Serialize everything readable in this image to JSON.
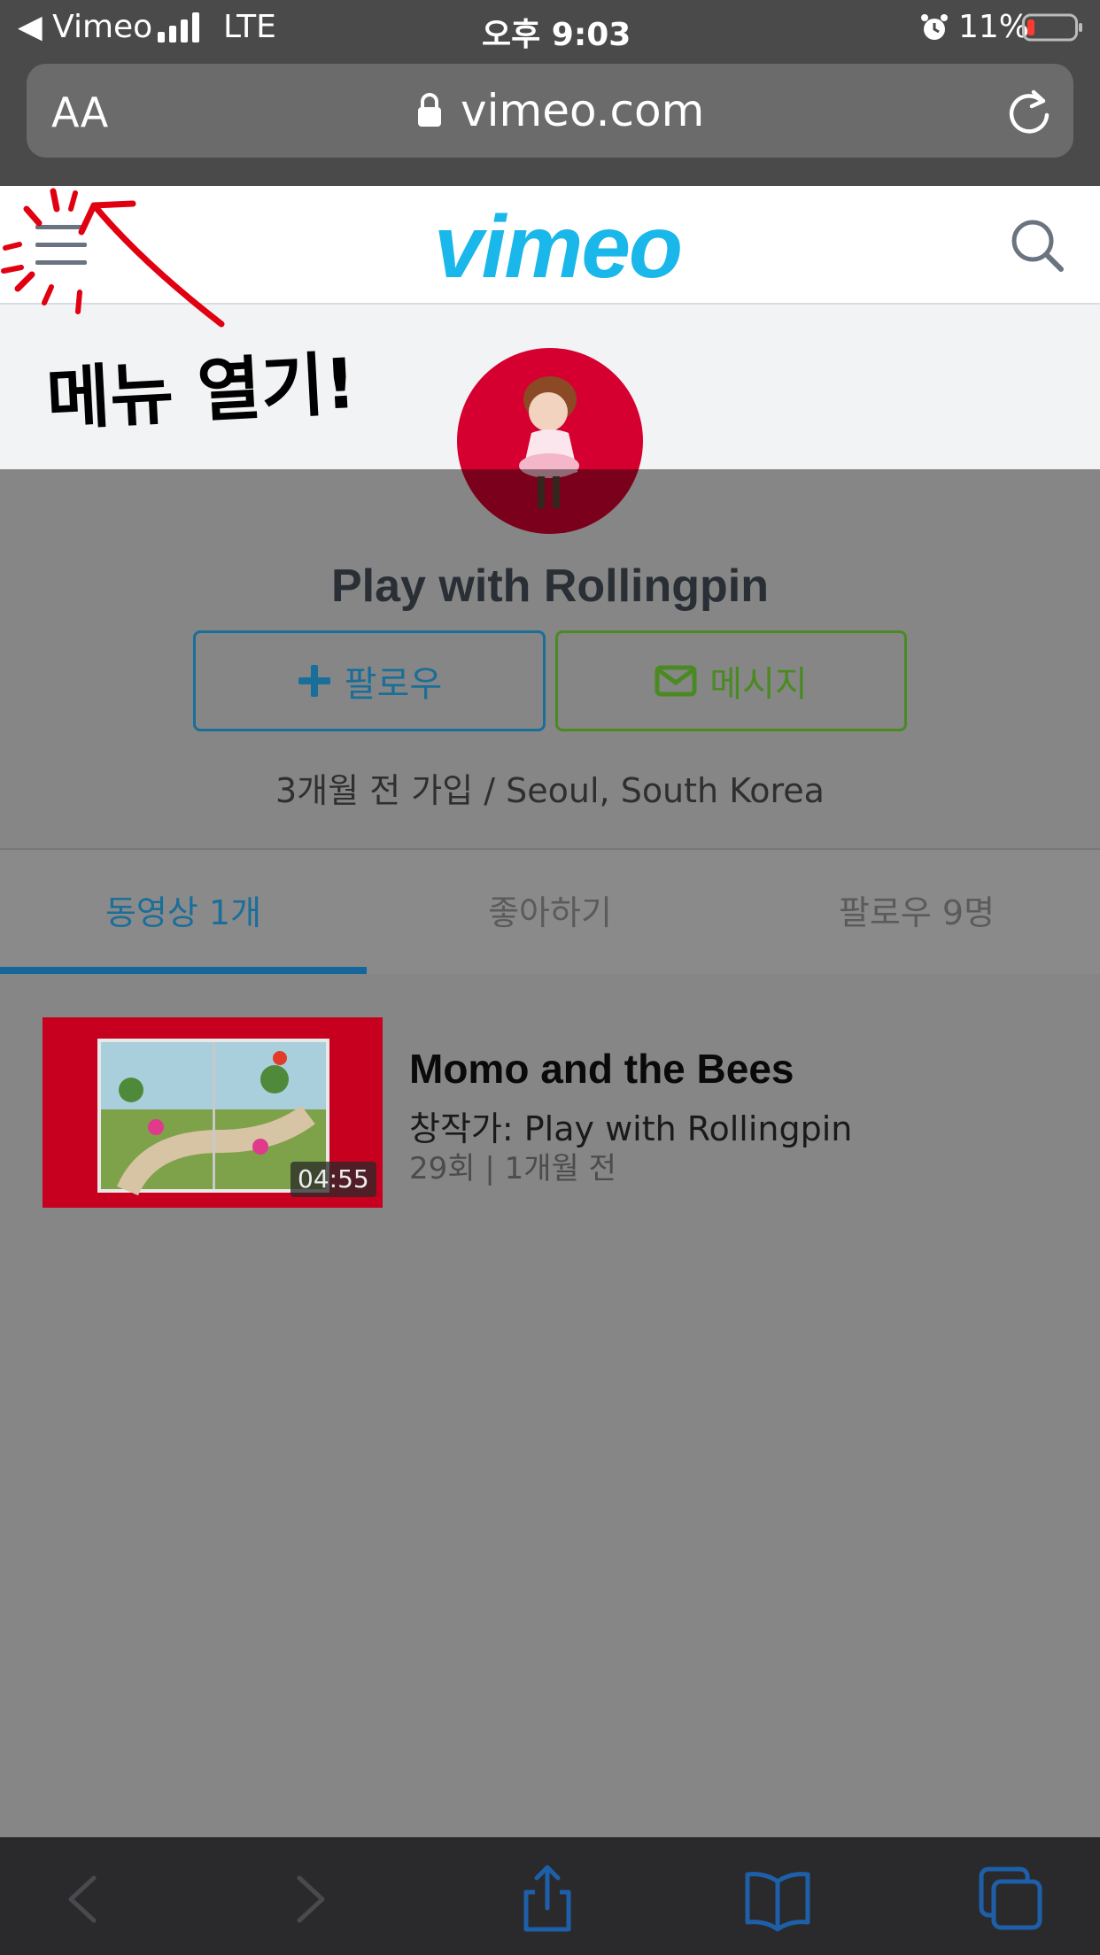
{
  "status_bar": {
    "carrier": "◀ Vimeo",
    "network": "LTE",
    "time": "오후 9:03",
    "battery": "11%"
  },
  "browser": {
    "text_size_label": "AA",
    "url": "vimeo.com"
  },
  "header": {
    "logo": "vimeo"
  },
  "annotation": {
    "text": "메뉴 열기!"
  },
  "profile": {
    "name": "Play with Rollingpin",
    "follow_label": "팔로우",
    "message_label": "메시지",
    "joined": "3개월 전 가입 / Seoul, South Korea"
  },
  "tabs": [
    {
      "label": "동영상 1개",
      "active": true
    },
    {
      "label": "좋아하기",
      "active": false
    },
    {
      "label": "팔로우 9명",
      "active": false
    }
  ],
  "video": {
    "title": "Momo and the Bees",
    "byline": "창작가: Play with Rollingpin",
    "meta": "29회 | 1개월 전",
    "duration": "04:55"
  },
  "colors": {
    "vimeo_blue": "#1ab7ea",
    "follow": "#1a6e9a",
    "message": "#4b8a22",
    "avatar_bg": "#d5002f",
    "annotation_red": "#e00010"
  }
}
